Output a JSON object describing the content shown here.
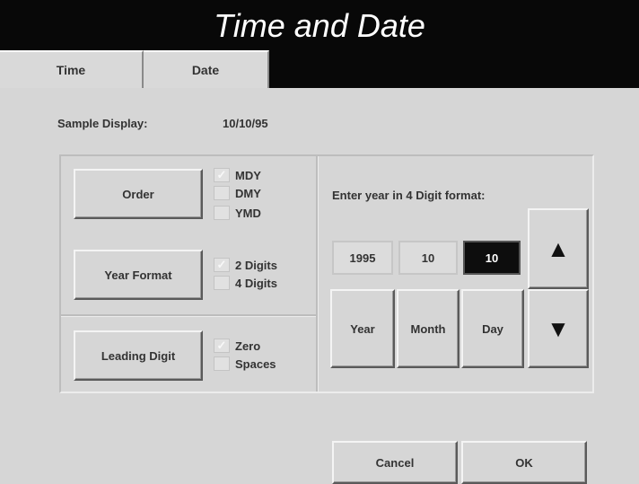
{
  "window": {
    "title": "Time and Date"
  },
  "tabs": [
    {
      "label": "Time"
    },
    {
      "label": "Date"
    }
  ],
  "sample": {
    "label": "Sample Display:",
    "value": "10/10/95"
  },
  "order": {
    "button_label": "Order",
    "options": [
      {
        "label": "MDY",
        "checked": true
      },
      {
        "label": "DMY",
        "checked": false
      },
      {
        "label": "YMD",
        "checked": false
      }
    ]
  },
  "year_format": {
    "button_label": "Year Format",
    "options": [
      {
        "label": "2 Digits",
        "checked": true
      },
      {
        "label": "4 Digits",
        "checked": false
      }
    ]
  },
  "leading_digit": {
    "button_label": "Leading Digit",
    "options": [
      {
        "label": "Zero",
        "checked": true
      },
      {
        "label": "Spaces",
        "checked": false
      }
    ]
  },
  "entry": {
    "hint": "Enter year in 4 Digit format:",
    "year_value": "1995",
    "month_value": "10",
    "day_value": "10",
    "active_field": "day",
    "year_label": "Year",
    "month_label": "Month",
    "day_label": "Day",
    "up_icon": "▲",
    "down_icon": "▼"
  },
  "footer": {
    "cancel_label": "Cancel",
    "ok_label": "OK"
  },
  "colors": {
    "titlebar": "#080808",
    "panel": "#d6d6d6",
    "active_field": "#0d0d0d"
  }
}
